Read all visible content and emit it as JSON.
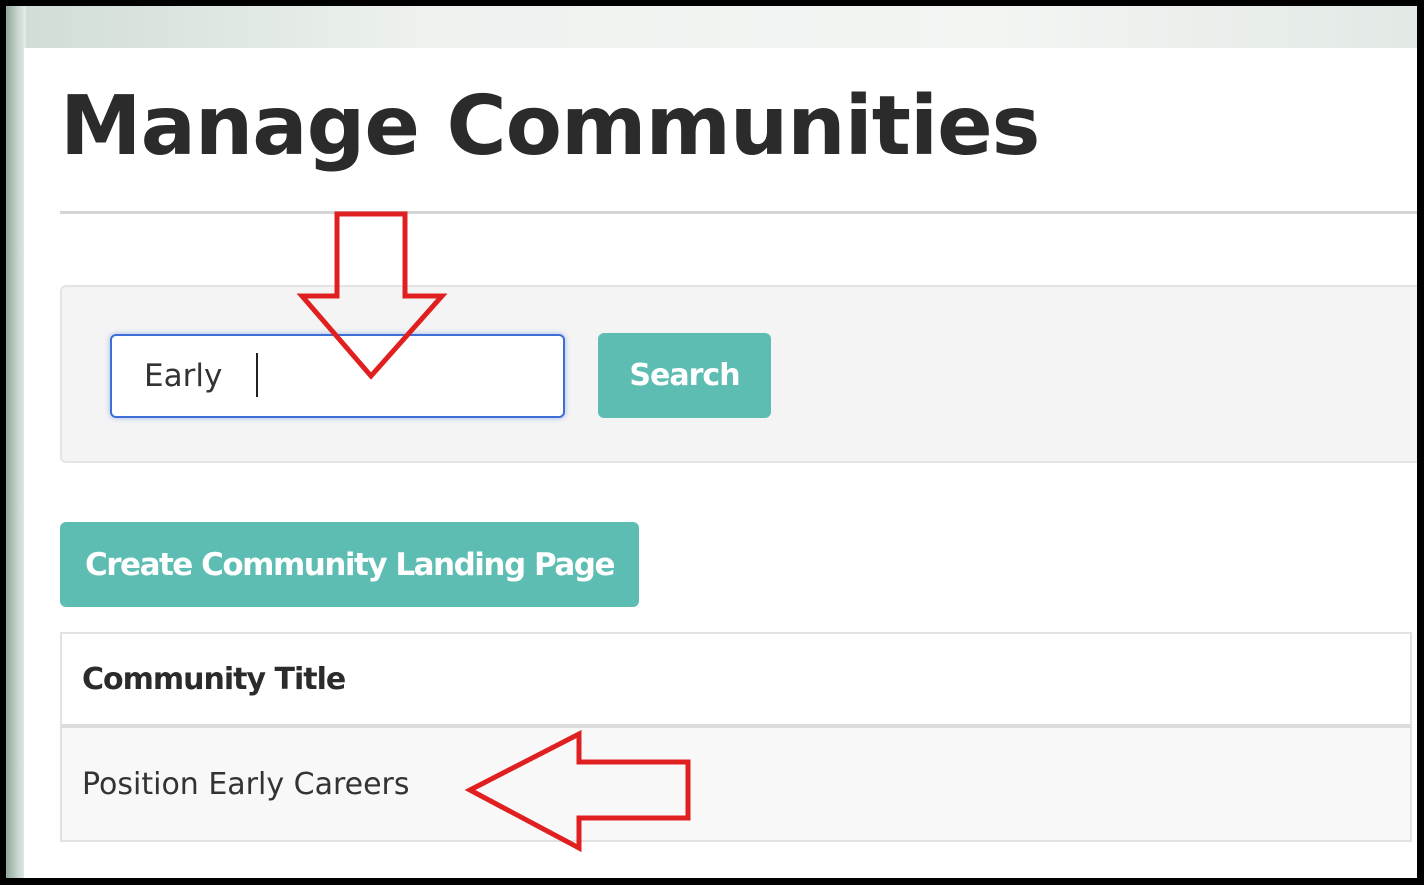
{
  "page": {
    "title": "Manage Communities"
  },
  "search": {
    "value": "Early",
    "button_label": "Search"
  },
  "actions": {
    "create_label": "Create Community Landing Page"
  },
  "table": {
    "columns": [
      "Community Title"
    ],
    "rows": [
      [
        "Position Early Careers"
      ]
    ]
  },
  "annotations": {
    "arrow_color": "#e02020"
  },
  "colors": {
    "accent": "#5ebdb2",
    "focus": "#3d6fd6",
    "title": "#2b2b2b"
  }
}
